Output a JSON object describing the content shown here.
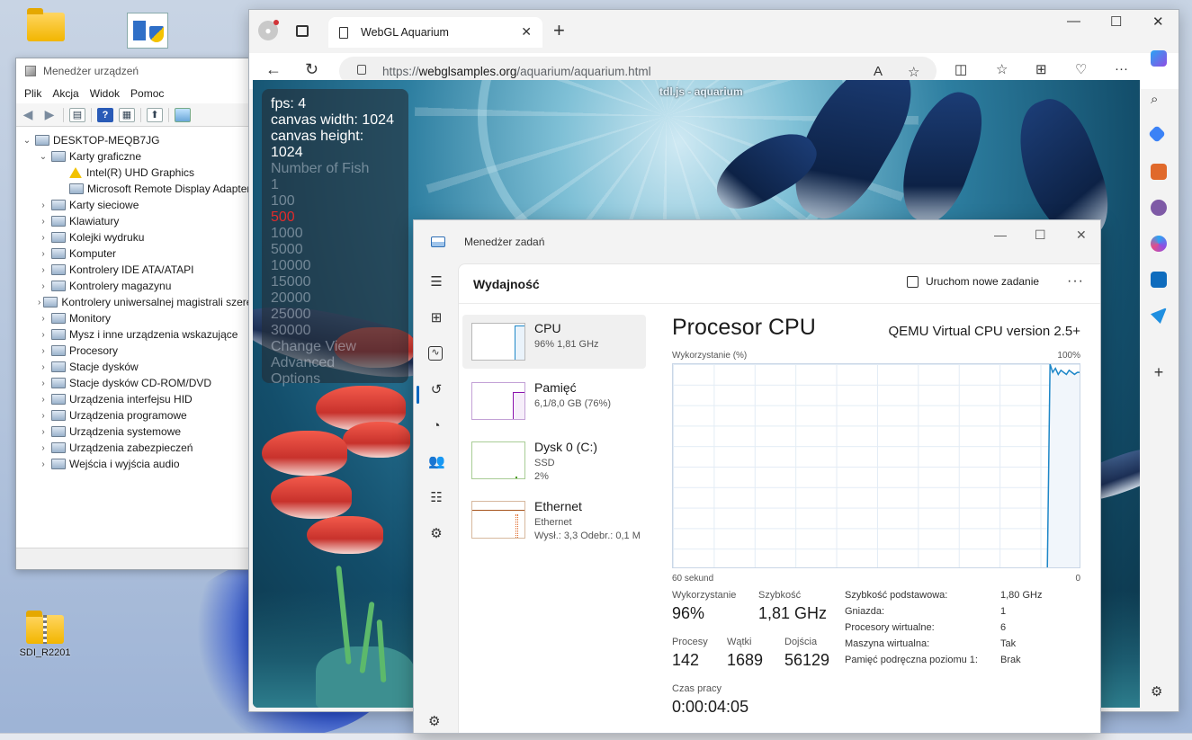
{
  "desktop": {
    "icons": [
      {
        "label": ""
      },
      {
        "label": ""
      },
      {
        "label": "SDI_R2201"
      }
    ]
  },
  "device_manager": {
    "title": "Menedżer urządzeń",
    "menu": [
      "Plik",
      "Akcja",
      "Widok",
      "Pomoc"
    ],
    "tree": {
      "root": "DESKTOP-MEQB7JG",
      "nodes": [
        {
          "label": "Karty graficzne",
          "expanded": true
        },
        {
          "label": "Intel(R) UHD Graphics",
          "warning": true
        },
        {
          "label": "Microsoft Remote Display Adapter"
        },
        {
          "label": "Karty sieciowe"
        },
        {
          "label": "Klawiatury"
        },
        {
          "label": "Kolejki wydruku"
        },
        {
          "label": "Komputer"
        },
        {
          "label": "Kontrolery IDE ATA/ATAPI"
        },
        {
          "label": "Kontrolery magazynu"
        },
        {
          "label": "Kontrolery uniwersalnej magistrali szeregowej"
        },
        {
          "label": "Monitory"
        },
        {
          "label": "Mysz i inne urządzenia wskazujące"
        },
        {
          "label": "Procesory"
        },
        {
          "label": "Stacje dysków"
        },
        {
          "label": "Stacje dysków CD-ROM/DVD"
        },
        {
          "label": "Urządzenia interfejsu HID"
        },
        {
          "label": "Urządzenia programowe"
        },
        {
          "label": "Urządzenia systemowe"
        },
        {
          "label": "Urządzenia zabezpieczeń"
        },
        {
          "label": "Wejścia i wyjścia audio"
        }
      ]
    }
  },
  "browser": {
    "tab_title": "WebGL Aquarium",
    "new_tab": "+",
    "url_prefix": "https://",
    "url_host": "webglsamples.org",
    "url_path": "/aquarium/aquarium.html",
    "accent_color": "#0067c0"
  },
  "aquarium": {
    "title": "tdl.js - aquarium",
    "stats": [
      "fps: 4",
      "canvas width: 1024",
      "canvas height: 1024"
    ],
    "fish_label": "Number of Fish",
    "fish_options": [
      "1",
      "100",
      "500",
      "1000",
      "5000",
      "10000",
      "15000",
      "20000",
      "25000",
      "30000"
    ],
    "selected_option": "500",
    "links": [
      "Change View",
      "Advanced",
      "Options"
    ]
  },
  "task_manager": {
    "title": "Menedżer zadań",
    "section": "Wydajność",
    "new_task": "Uruchom nowe zadanie",
    "more": "···",
    "devices": [
      {
        "name": "CPU",
        "sub1": "96%  1,81 GHz",
        "sub2": "",
        "color": "#1d87c8",
        "selected": true
      },
      {
        "name": "Pamięć",
        "sub1": "6,1/8,0 GB (76%)",
        "sub2": "",
        "color": "#8b12ae",
        "selected": false
      },
      {
        "name": "Dysk 0 (C:)",
        "sub1": "SSD",
        "sub2": "2%",
        "color": "#4c9a1f",
        "selected": false
      },
      {
        "name": "Ethernet",
        "sub1": "Ethernet",
        "sub2": "Wysł.: 3,3  Odebr.: 0,1 M",
        "color": "#a7541d",
        "selected": false
      }
    ],
    "cpu": {
      "title": "Procesor CPU",
      "model": "QEMU Virtual CPU version 2.5+",
      "y_label": "Wykorzystanie (%)",
      "y_max_label": "100%",
      "x_left_label": "60 sekund",
      "x_right_label": "0",
      "stats": {
        "util_label": "Wykorzystanie",
        "util_value": "96%",
        "speed_label": "Szybkość",
        "speed_value": "1,81 GHz",
        "proc_label": "Procesy",
        "proc_value": "142",
        "thr_label": "Wątki",
        "thr_value": "1689",
        "handles_label": "Dojścia",
        "handles_value": "56129",
        "uptime_label": "Czas pracy",
        "uptime_value": "0:00:04:05"
      },
      "details": [
        {
          "k": "Szybkość podstawowa:",
          "v": "1,80 GHz"
        },
        {
          "k": "Gniazda:",
          "v": "1"
        },
        {
          "k": "Procesory wirtualne:",
          "v": "6"
        },
        {
          "k": "Maszyna wirtualna:",
          "v": "Tak"
        },
        {
          "k": "Pamięć podręczna poziomu 1:",
          "v": "Brak"
        }
      ]
    }
  },
  "chart_data": {
    "type": "line",
    "title": "Procesor CPU",
    "ylabel": "Wykorzystanie (%)",
    "xlabel": "60 sekund",
    "ylim": [
      0,
      100
    ],
    "xlim": [
      60,
      0
    ],
    "series": [
      {
        "x": [
          60,
          5,
          4.6,
          4.2,
          3.8,
          3.4,
          3,
          2.6,
          2.2,
          1.8,
          1.4,
          1,
          0.6,
          0
        ],
        "values": [
          0,
          0,
          100,
          96,
          98,
          95,
          97,
          96,
          95,
          97,
          96,
          95,
          96,
          96
        ]
      }
    ]
  }
}
